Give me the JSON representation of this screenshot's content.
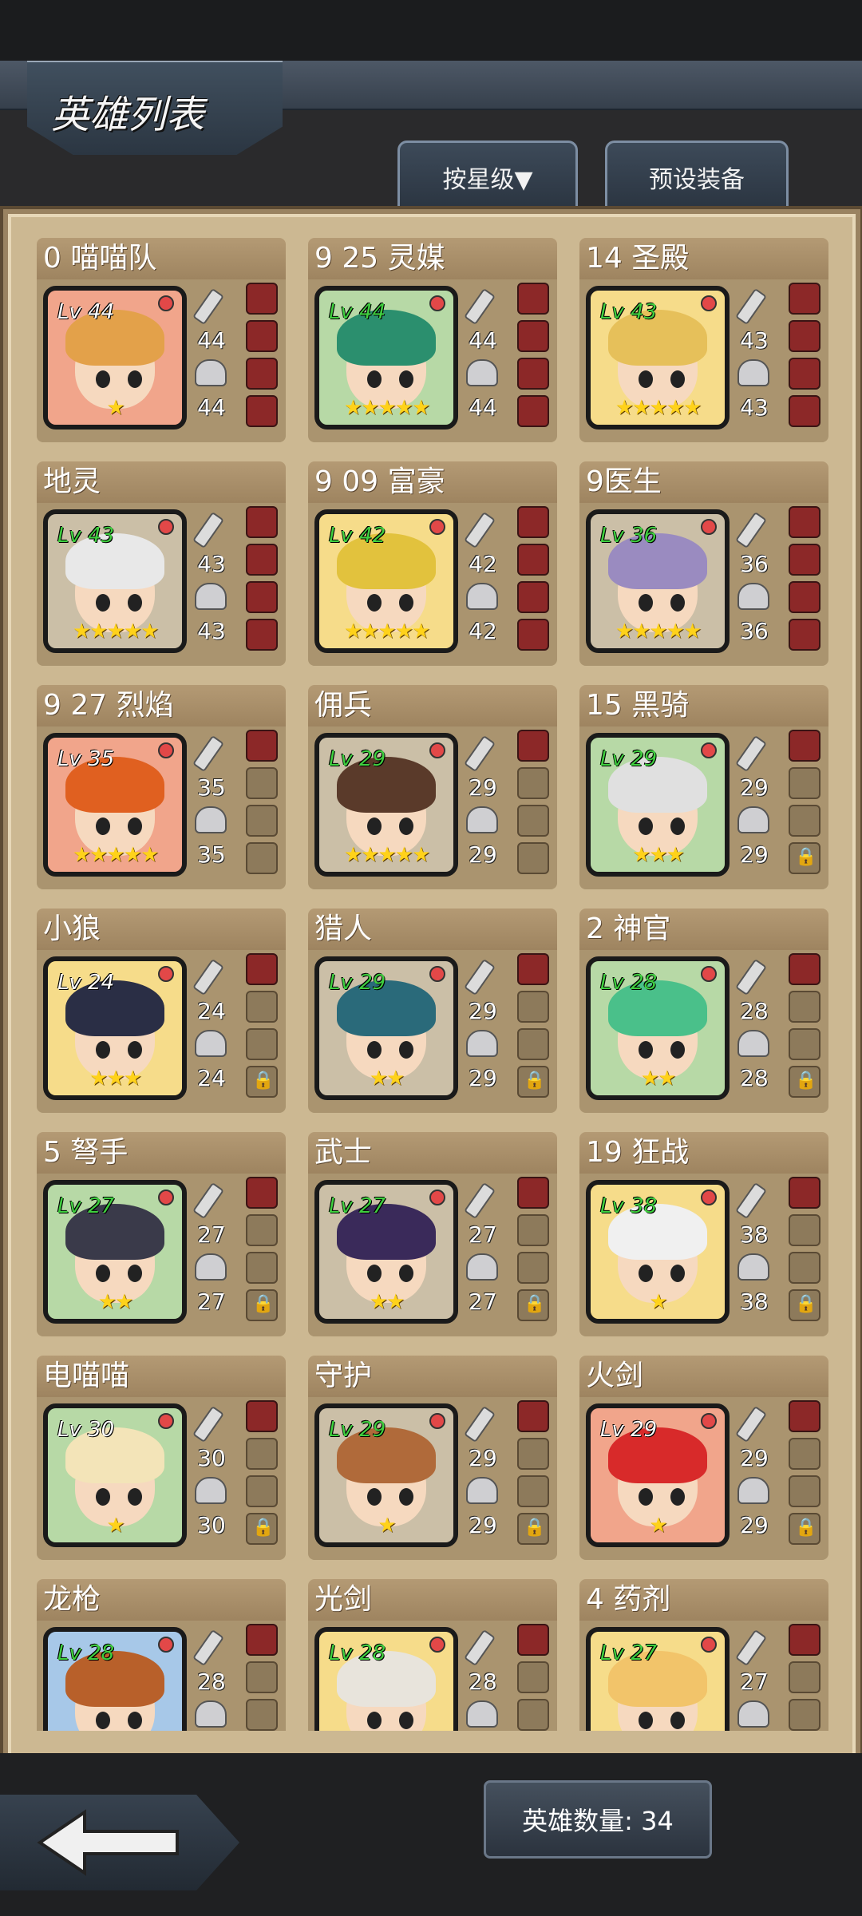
{
  "header": {
    "title": "英雄列表",
    "sort_label": "按星级▼",
    "preset_label": "预设装备"
  },
  "footer": {
    "hero_count_label": "英雄数量: 34"
  },
  "colors": {
    "panel": "#ccb892",
    "level_green": "#3fcf3f",
    "star": "#ffd21a",
    "equip_slot": "#8c2828"
  },
  "heroes": [
    {
      "name": "0 喵喵队",
      "lv": "Lv 44",
      "atk": "44",
      "def": "44",
      "stars": "★",
      "frame": "red",
      "slots": [
        "equip",
        "equip",
        "equip",
        "equip"
      ]
    },
    {
      "name": "9 25 灵媒",
      "lv": "Lv 44",
      "atk": "44",
      "def": "44",
      "stars": "★★★★★",
      "frame": "green",
      "slots": [
        "equip",
        "equip",
        "equip",
        "equip"
      ]
    },
    {
      "name": "14 圣殿",
      "lv": "Lv 43",
      "atk": "43",
      "def": "43",
      "stars": "★★★★★",
      "frame": "gold",
      "slots": [
        "equip",
        "equip",
        "equip",
        "equip"
      ]
    },
    {
      "name": "地灵",
      "lv": "Lv 43",
      "atk": "43",
      "def": "43",
      "stars": "★★★★★",
      "frame": "dark",
      "slots": [
        "equip",
        "equip",
        "equip",
        "equip"
      ]
    },
    {
      "name": "9 09 富豪",
      "lv": "Lv 42",
      "atk": "42",
      "def": "42",
      "stars": "★★★★★",
      "frame": "gold",
      "slots": [
        "equip",
        "equip",
        "equip",
        "equip"
      ]
    },
    {
      "name": "9医生",
      "lv": "Lv 36",
      "atk": "36",
      "def": "36",
      "stars": "★★★★★",
      "frame": "dark",
      "slots": [
        "equip",
        "equip",
        "equip",
        "equip"
      ]
    },
    {
      "name": "9 27 烈焰",
      "lv": "Lv 35",
      "atk": "35",
      "def": "35",
      "stars": "★★★★★",
      "frame": "red",
      "slots": [
        "equip",
        "empty",
        "empty",
        "empty"
      ]
    },
    {
      "name": "佣兵",
      "lv": "Lv 29",
      "atk": "29",
      "def": "29",
      "stars": "★★★★★",
      "frame": "dark",
      "slots": [
        "equip",
        "empty",
        "empty",
        "empty"
      ]
    },
    {
      "name": "15 黑骑",
      "lv": "Lv 29",
      "atk": "29",
      "def": "29",
      "stars": "★★★",
      "frame": "green",
      "slots": [
        "equip",
        "empty",
        "empty",
        "locked"
      ]
    },
    {
      "name": "小狼",
      "lv": "Lv 24",
      "atk": "24",
      "def": "24",
      "stars": "★★★",
      "frame": "gold",
      "slots": [
        "equip",
        "empty",
        "empty",
        "locked"
      ]
    },
    {
      "name": "猎人",
      "lv": "Lv 29",
      "atk": "29",
      "def": "29",
      "stars": "★★",
      "frame": "dark",
      "slots": [
        "equip",
        "empty",
        "empty",
        "locked"
      ]
    },
    {
      "name": "2 神官",
      "lv": "Lv 28",
      "atk": "28",
      "def": "28",
      "stars": "★★",
      "frame": "green",
      "slots": [
        "equip",
        "empty",
        "empty",
        "locked"
      ]
    },
    {
      "name": "5 弩手",
      "lv": "Lv 27",
      "atk": "27",
      "def": "27",
      "stars": "★★",
      "frame": "green",
      "slots": [
        "equip",
        "empty",
        "empty",
        "locked"
      ]
    },
    {
      "name": "武士",
      "lv": "Lv 27",
      "atk": "27",
      "def": "27",
      "stars": "★★",
      "frame": "dark",
      "slots": [
        "equip",
        "empty",
        "empty",
        "locked"
      ]
    },
    {
      "name": "19 狂战",
      "lv": "Lv 38",
      "atk": "38",
      "def": "38",
      "stars": "★",
      "frame": "gold",
      "slots": [
        "equip",
        "empty",
        "empty",
        "locked"
      ]
    },
    {
      "name": "电喵喵",
      "lv": "Lv 30",
      "atk": "30",
      "def": "30",
      "stars": "★",
      "frame": "green",
      "slots": [
        "equip",
        "empty",
        "empty",
        "locked"
      ]
    },
    {
      "name": "守护",
      "lv": "Lv 29",
      "atk": "29",
      "def": "29",
      "stars": "★",
      "frame": "dark",
      "slots": [
        "equip",
        "empty",
        "empty",
        "locked"
      ]
    },
    {
      "name": "火剑",
      "lv": "Lv 29",
      "atk": "29",
      "def": "29",
      "stars": "★",
      "frame": "red",
      "slots": [
        "equip",
        "empty",
        "empty",
        "locked"
      ]
    },
    {
      "name": "龙枪",
      "lv": "Lv 28",
      "atk": "28",
      "def": "",
      "stars": "",
      "frame": "blue",
      "slots": [
        "equip",
        "empty",
        "empty",
        "empty"
      ]
    },
    {
      "name": "光剑",
      "lv": "Lv 28",
      "atk": "28",
      "def": "",
      "stars": "",
      "frame": "gold",
      "slots": [
        "equip",
        "empty",
        "empty",
        "empty"
      ]
    },
    {
      "name": "4 药剂",
      "lv": "Lv 27",
      "atk": "27",
      "def": "",
      "stars": "",
      "frame": "gold",
      "slots": [
        "equip",
        "empty",
        "empty",
        "empty"
      ]
    }
  ]
}
